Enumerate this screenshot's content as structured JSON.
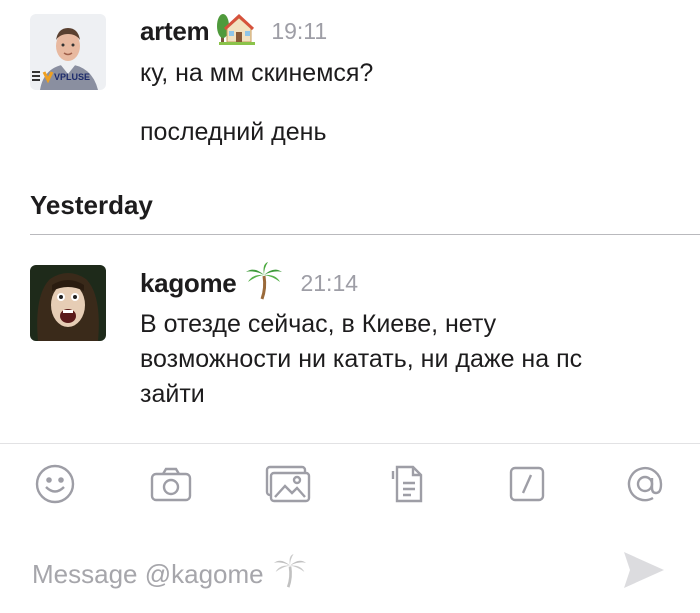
{
  "messages_before": [
    {
      "author": "artem",
      "author_emoji": "house-with-tree-emoji",
      "time": "19:11",
      "avatar_badge": "VPLUSE",
      "lines": [
        "ку, на мм скинемся?",
        "последний день"
      ]
    }
  ],
  "day_divider": "Yesterday",
  "messages_after": [
    {
      "author": "kagome",
      "author_emoji": "palm-tree-emoji",
      "time": "21:14",
      "lines": [
        "В отезде сейчас, в Киеве, нету",
        "возможности ни катать, ни даже на пс",
        "зайти"
      ]
    }
  ],
  "toolbar": {
    "icons": [
      "smiley-icon",
      "camera-icon",
      "photos-icon",
      "files-icon",
      "slash-command-icon",
      "mention-icon"
    ],
    "icon_color": "#9e9ea6"
  },
  "composer": {
    "placeholder": "Message @kagome",
    "placeholder_emoji": "palm-tree-emoji",
    "send_icon": "send-icon"
  },
  "colors": {
    "text": "#1d1c1d",
    "muted": "#9e9ea6",
    "divider": "#b9b9bd"
  }
}
